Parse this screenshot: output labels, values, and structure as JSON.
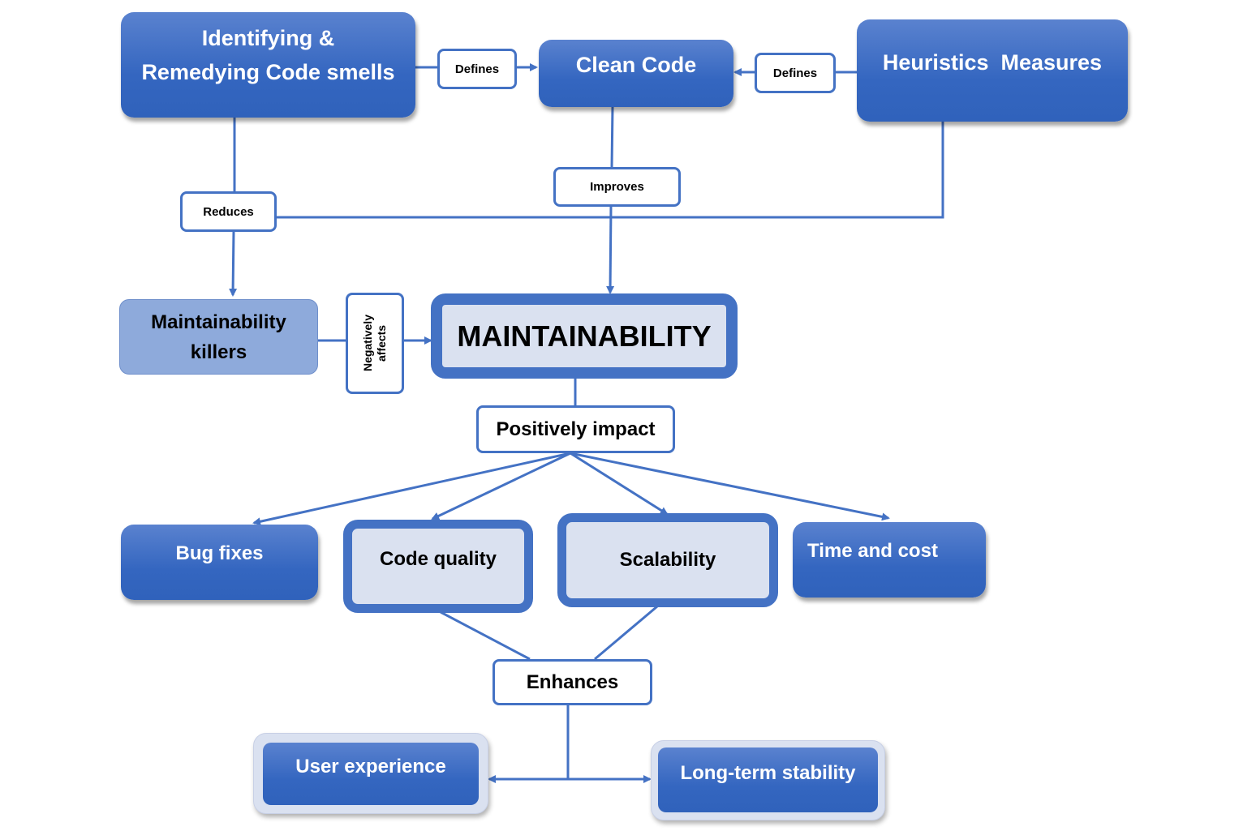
{
  "diagram": {
    "colors": {
      "primary": "#4472c4",
      "dark_blue": "#3466c0",
      "light_fill": "#dae1f0",
      "killer_fill": "#8eaadb"
    },
    "nodes": {
      "code_smells": "Identifying &\nRemedying Code smells",
      "clean_code": "Clean Code",
      "heuristics": "Heuristics  Measures",
      "killers": "Maintainability\nkillers",
      "maintainability": "MAINTAINABILITY",
      "bug_fixes": "Bug fixes",
      "code_quality": "Code quality",
      "scalability": "Scalability",
      "time_cost": "Time and cost",
      "user_experience": "User experience",
      "long_term": "Long-term stability"
    },
    "edge_labels": {
      "defines_left": "Defines",
      "defines_right": "Defines",
      "reduces": "Reduces",
      "improves": "Improves",
      "negatively_affects": "Negatively\naffects",
      "positively_impact": "Positively impact",
      "enhances": "Enhances"
    },
    "edges": [
      {
        "from": "code_smells",
        "to": "clean_code",
        "label": "Defines"
      },
      {
        "from": "heuristics",
        "to": "clean_code",
        "label": "Defines"
      },
      {
        "from": "code_smells",
        "to": "killers",
        "label": "Reduces"
      },
      {
        "from": "heuristics",
        "to": "killers",
        "label": "Reduces"
      },
      {
        "from": "clean_code",
        "to": "maintainability",
        "label": "Improves"
      },
      {
        "from": "killers",
        "to": "maintainability",
        "label": "Negatively affects"
      },
      {
        "from": "maintainability",
        "to": "bug_fixes",
        "label": "Positively impact"
      },
      {
        "from": "maintainability",
        "to": "code_quality",
        "label": "Positively impact"
      },
      {
        "from": "maintainability",
        "to": "scalability",
        "label": "Positively impact"
      },
      {
        "from": "maintainability",
        "to": "time_cost",
        "label": "Positively impact"
      },
      {
        "from": "code_quality",
        "to": "user_experience",
        "label": "Enhances"
      },
      {
        "from": "scalability",
        "to": "long_term_stability",
        "label": "Enhances"
      }
    ]
  }
}
